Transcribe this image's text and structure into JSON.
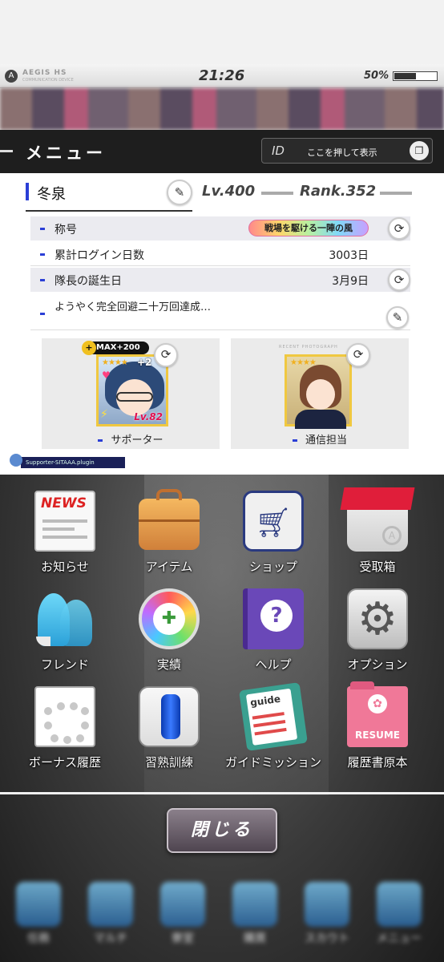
{
  "status_bar": {
    "app_name": "AEGIS HS",
    "app_sub": "COMMUNICATION DEVICE",
    "time": "21:26",
    "battery_percent": "50%",
    "battery_level": 0.5
  },
  "menu": {
    "title": "メニュー",
    "id_label": "ID",
    "id_prompt": "ここを押して表示"
  },
  "profile": {
    "name": "冬泉",
    "level": "Lv.400",
    "rank": "Rank.352",
    "rows": [
      {
        "label": "称号",
        "value": "戦場を駆ける一陣の風"
      },
      {
        "label": "累計ログイン日数",
        "value": "3003日"
      },
      {
        "label": "隊長の誕生日",
        "value": "3月9日"
      },
      {
        "label": "ようやく完全回避二十万回達成…",
        "value": ""
      }
    ]
  },
  "cards": {
    "supporter": {
      "label": "サポーター",
      "max_tag": "MAX+200",
      "stars": "★★★★",
      "plus": "+2",
      "level": "Lv.82"
    },
    "comm": {
      "label": "通信担当",
      "stars": "★★★★",
      "caption": "RECENT PHOTOGRAPH"
    }
  },
  "plugin_tag": "Supporter-SITAAA.plugin",
  "grid": [
    {
      "label": "お知らせ",
      "icon": "news-icon"
    },
    {
      "label": "アイテム",
      "icon": "bag-icon"
    },
    {
      "label": "ショップ",
      "icon": "cart-icon"
    },
    {
      "label": "受取箱",
      "icon": "box-icon"
    },
    {
      "label": "フレンド",
      "icon": "friends-icon"
    },
    {
      "label": "実績",
      "icon": "controller-icon"
    },
    {
      "label": "ヘルプ",
      "icon": "help-icon"
    },
    {
      "label": "オプション",
      "icon": "gear-icon"
    },
    {
      "label": "ボーナス履歴",
      "icon": "bonus-icon"
    },
    {
      "label": "習熟訓練",
      "icon": "punching-bag-icon"
    },
    {
      "label": "ガイドミッション",
      "icon": "guide-icon"
    },
    {
      "label": "履歴書原本",
      "icon": "resume-icon"
    }
  ],
  "news_badge": "NEWS",
  "guide_badge": "guide",
  "resume_badge": "RESUME",
  "close_label": "閉じる",
  "bottom_nav": [
    "任務",
    "マルチ",
    "寮室",
    "購買",
    "スカウト",
    "メニュー"
  ]
}
